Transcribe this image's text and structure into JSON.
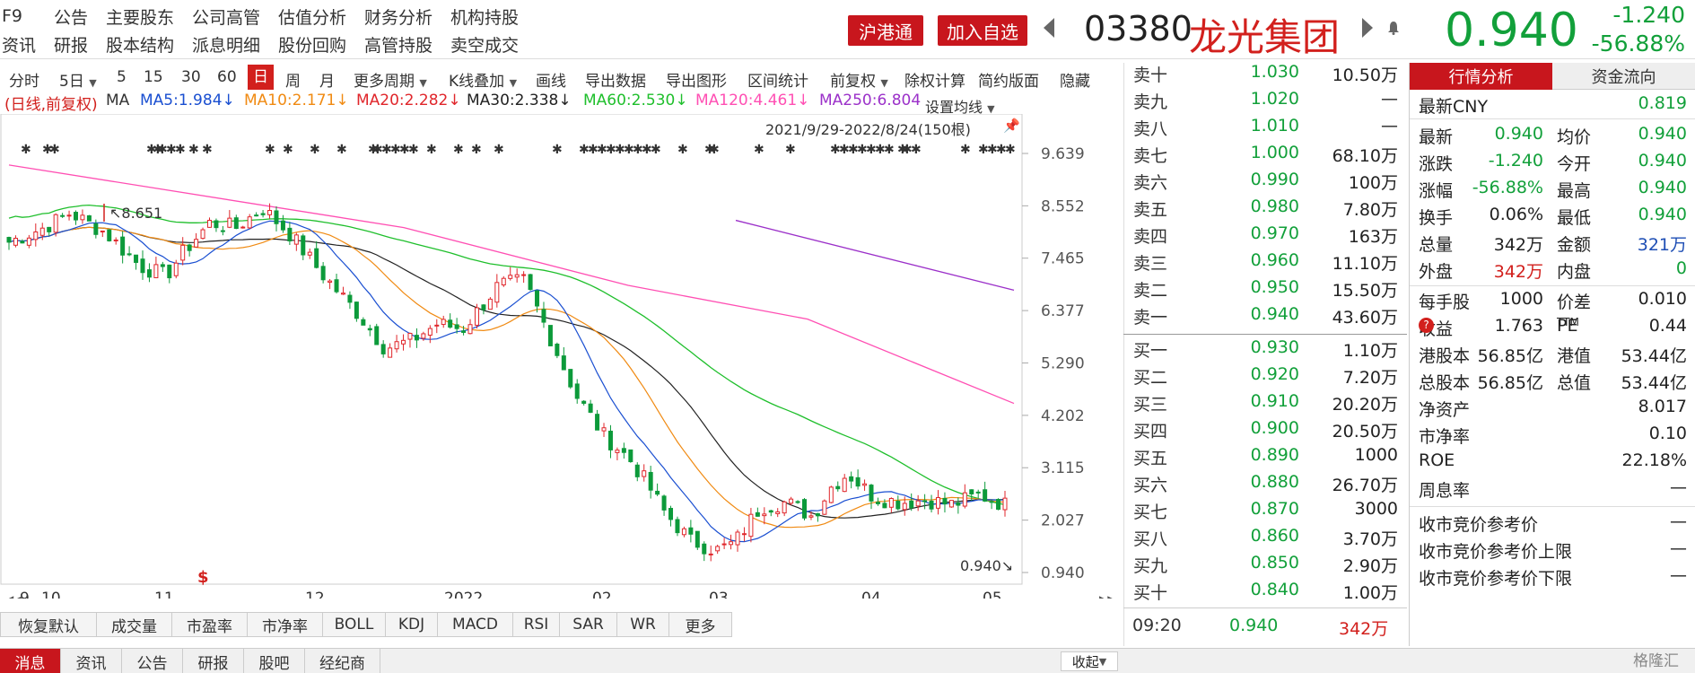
{
  "topbar": {
    "row1": [
      "F9",
      "公告",
      "主要股东",
      "公司高管",
      "估值分析",
      "财务分析",
      "机构持股"
    ],
    "row2": [
      "资讯",
      "研报",
      "股本结构",
      "派息明细",
      "股份回购",
      "高管持股",
      "卖空成交"
    ],
    "hk_connect": "沪港通",
    "add_watch": "加入自选",
    "code": "03380",
    "name": "龙光集团",
    "price": "0.940",
    "change": "-1.240",
    "change_pct": "-56.88%"
  },
  "toolbar": {
    "items": [
      "分时",
      "5日",
      "5",
      "15",
      "30",
      "60",
      "日",
      "周",
      "月",
      "更多周期",
      "K线叠加",
      "画线",
      "导出数据",
      "导出图形",
      "区间统计",
      "前复权",
      "除权计算",
      "简约版面",
      "隐藏"
    ]
  },
  "ma_legend": {
    "mode": "(日线,前复权)",
    "ma": "MA",
    "ma5": "MA5:1.984↓",
    "ma10": "MA10:2.171↓",
    "ma20": "MA20:2.282↓",
    "ma30": "MA30:2.338↓",
    "ma60": "MA60:2.530↓",
    "ma120": "MA120:4.461↓",
    "ma250": "MA250:6.804",
    "set_ma": "设置均线",
    "range": "2021/9/29-2022/8/24(150根)"
  },
  "chart_data": {
    "type": "candlestick",
    "y_ticks": [
      "9.639",
      "8.552",
      "7.465",
      "6.377",
      "5.290",
      "4.202",
      "3.115",
      "2.027",
      "0.940"
    ],
    "x_labels": [
      "9",
      "10",
      "11",
      "12",
      "2022",
      "02",
      "03",
      "04",
      "05"
    ],
    "ylim": [
      0.94,
      9.639
    ],
    "high_label": "8.651",
    "low_label": "0.940",
    "colors": {
      "up": "#e0262b",
      "down": "#0c9a3a",
      "ma5": "#1a4fd1",
      "ma10": "#f08a12",
      "ma20": "#222222",
      "ma60": "#1fbf2c",
      "ma120": "#ff4fb3",
      "ma250": "#9b30c9"
    }
  },
  "indicator_tabs": [
    "恢复默认",
    "成交量",
    "市盈率",
    "市净率",
    "BOLL",
    "KDJ",
    "MACD",
    "RSI",
    "SAR",
    "WR",
    "更多"
  ],
  "bottom_tabs": [
    "消息",
    "资讯",
    "公告",
    "研报",
    "股吧",
    "经纪商"
  ],
  "collapse": "收起",
  "watermark": "格隆汇",
  "orderbook": {
    "asks": [
      {
        "label": "卖十",
        "price": "1.030",
        "vol": "10.50万"
      },
      {
        "label": "卖九",
        "price": "1.020",
        "vol": "—"
      },
      {
        "label": "卖八",
        "price": "1.010",
        "vol": "—"
      },
      {
        "label": "卖七",
        "price": "1.000",
        "vol": "68.10万"
      },
      {
        "label": "卖六",
        "price": "0.990",
        "vol": "100万"
      },
      {
        "label": "卖五",
        "price": "0.980",
        "vol": "7.80万"
      },
      {
        "label": "卖四",
        "price": "0.970",
        "vol": "163万"
      },
      {
        "label": "卖三",
        "price": "0.960",
        "vol": "11.10万"
      },
      {
        "label": "卖二",
        "price": "0.950",
        "vol": "15.50万"
      },
      {
        "label": "卖一",
        "price": "0.940",
        "vol": "43.60万"
      }
    ],
    "bids": [
      {
        "label": "买一",
        "price": "0.930",
        "vol": "1.10万"
      },
      {
        "label": "买二",
        "price": "0.920",
        "vol": "7.20万"
      },
      {
        "label": "买三",
        "price": "0.910",
        "vol": "20.20万"
      },
      {
        "label": "买四",
        "price": "0.900",
        "vol": "20.50万"
      },
      {
        "label": "买五",
        "price": "0.890",
        "vol": "1000"
      },
      {
        "label": "买六",
        "price": "0.880",
        "vol": "26.70万"
      },
      {
        "label": "买七",
        "price": "0.870",
        "vol": "3000"
      },
      {
        "label": "买八",
        "price": "0.860",
        "vol": "3.70万"
      },
      {
        "label": "买九",
        "price": "0.850",
        "vol": "2.90万"
      },
      {
        "label": "买十",
        "price": "0.840",
        "vol": "1.00万"
      }
    ],
    "tick": {
      "time": "09:20",
      "price": "0.940",
      "vol": "342万"
    }
  },
  "quote": {
    "tab_active": "行情分析",
    "tab_other": "资金流向",
    "latest_cny_label": "最新CNY",
    "latest_cny": "0.819",
    "rows": [
      {
        "l1": "最新",
        "v1": "0.940",
        "c1": "green",
        "l2": "均价",
        "v2": "0.940",
        "c2": "green"
      },
      {
        "l1": "涨跌",
        "v1": "-1.240",
        "c1": "green",
        "l2": "今开",
        "v2": "0.940",
        "c2": "green"
      },
      {
        "l1": "涨幅",
        "v1": "-56.88%",
        "c1": "green",
        "l2": "最高",
        "v2": "0.940",
        "c2": "green"
      },
      {
        "l1": "换手",
        "v1": "0.06%",
        "c1": "",
        "l2": "最低",
        "v2": "0.940",
        "c2": "green"
      },
      {
        "l1": "总量",
        "v1": "342万",
        "c1": "",
        "l2": "金额",
        "v2": "321万",
        "c2": "blue"
      },
      {
        "l1": "外盘",
        "v1": "342万",
        "c1": "red",
        "l2": "内盘",
        "v2": "0",
        "c2": "green"
      }
    ],
    "rows2": [
      {
        "l1": "每手股",
        "v1": "1000",
        "l2": "价差",
        "v2": "0.010"
      },
      {
        "l1": "收益",
        "v1": "1.763",
        "l2": "PE",
        "v2": "0.44"
      },
      {
        "l1": "港股本",
        "v1": "56.85亿",
        "l2": "港值",
        "v2": "53.44亿"
      },
      {
        "l1": "总股本",
        "v1": "56.85亿",
        "l2": "总值",
        "v2": "53.44亿"
      }
    ],
    "pe_sup": "TTM",
    "eps_icon": "?",
    "singles": [
      {
        "l": "净资产",
        "v": "8.017"
      },
      {
        "l": "市净率",
        "v": "0.10"
      },
      {
        "l": "ROE",
        "v": "22.18%"
      },
      {
        "l": "周息率",
        "v": "—"
      }
    ],
    "auction": [
      {
        "l": "收市竞价参考价",
        "v": "—"
      },
      {
        "l": "收市竞价参考价上限",
        "v": "—"
      },
      {
        "l": "收市竞价参考价下限",
        "v": "—"
      }
    ]
  }
}
